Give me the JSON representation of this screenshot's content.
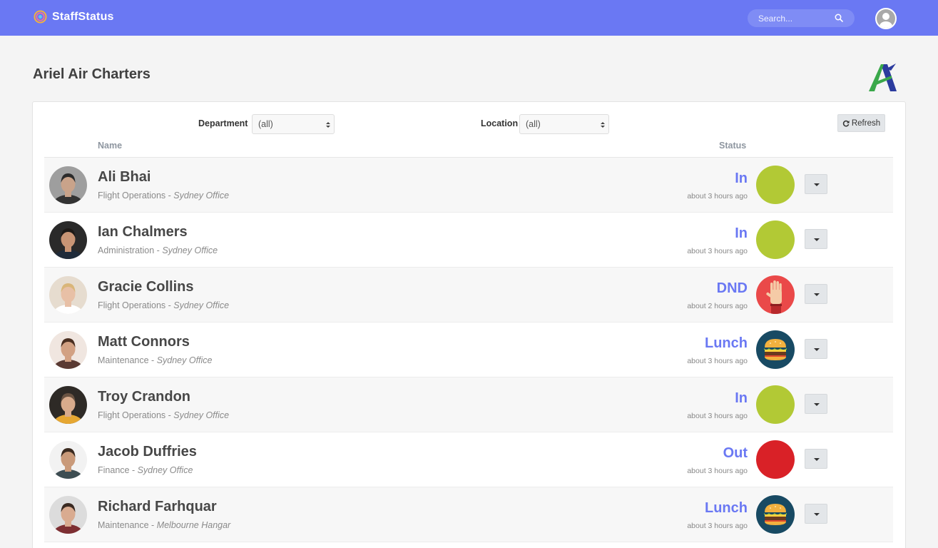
{
  "app": {
    "brand": "StaffStatus",
    "search_placeholder": "Search..."
  },
  "page": {
    "title": "Ariel Air Charters"
  },
  "filters": {
    "department_label": "Department",
    "department_value": "(all)",
    "location_label": "Location",
    "location_value": "(all)",
    "refresh_label": "Refresh"
  },
  "table": {
    "name_header": "Name",
    "status_header": "Status",
    "rows": [
      {
        "name": "Ali Bhai",
        "department": "Flight Operations",
        "location": "Sydney Office",
        "status": "In",
        "ago": "about 3 hours ago",
        "status_kind": "in",
        "avatar_skin": "#c9a38a",
        "avatar_hair": "#2b2b2b",
        "avatar_bg": "#9e9e9e",
        "avatar_shirt": "#333333"
      },
      {
        "name": "Ian Chalmers",
        "department": "Administration",
        "location": "Sydney Office",
        "status": "In",
        "ago": "about 3 hours ago",
        "status_kind": "in",
        "avatar_skin": "#c99575",
        "avatar_hair": "#1e1a17",
        "avatar_bg": "#2a2a2a",
        "avatar_shirt": "#1f2b3a"
      },
      {
        "name": "Gracie Collins",
        "department": "Flight Operations",
        "location": "Sydney Office",
        "status": "DND",
        "ago": "about 2 hours ago",
        "status_kind": "dnd",
        "avatar_skin": "#e8c0a6",
        "avatar_hair": "#d9b679",
        "avatar_bg": "#e6dccf",
        "avatar_shirt": "#ffffff"
      },
      {
        "name": "Matt Connors",
        "department": "Maintenance",
        "location": "Sydney Office",
        "status": "Lunch",
        "ago": "about 3 hours ago",
        "status_kind": "lunch",
        "avatar_skin": "#d2a183",
        "avatar_hair": "#4a2f21",
        "avatar_bg": "#f0e6e0",
        "avatar_shirt": "#5a3a33"
      },
      {
        "name": "Troy Crandon",
        "department": "Flight Operations",
        "location": "Sydney Office",
        "status": "In",
        "ago": "about 3 hours ago",
        "status_kind": "in",
        "avatar_skin": "#d8ab8c",
        "avatar_hair": "#6b5443",
        "avatar_bg": "#2e2a26",
        "avatar_shirt": "#e6a732"
      },
      {
        "name": "Jacob Duffries",
        "department": "Finance",
        "location": "Sydney Office",
        "status": "Out",
        "ago": "about 3 hours ago",
        "status_kind": "out",
        "avatar_skin": "#c99a7a",
        "avatar_hair": "#3a2a20",
        "avatar_bg": "#f2f2f2",
        "avatar_shirt": "#3d4d52"
      },
      {
        "name": "Richard Farhquar",
        "department": "Maintenance",
        "location": "Melbourne Hangar",
        "status": "Lunch",
        "ago": "about 3 hours ago",
        "status_kind": "lunch",
        "avatar_skin": "#d9ab90",
        "avatar_hair": "#3a2a22",
        "avatar_bg": "#dcdcdc",
        "avatar_shirt": "#7d2f33"
      }
    ]
  },
  "colors": {
    "navbar": "#6a78f3",
    "accent": "#6a78f3",
    "status_in": "#b2c935",
    "status_out": "#d92127",
    "status_dnd": "#ea4949",
    "status_lunch": "#184a63"
  }
}
